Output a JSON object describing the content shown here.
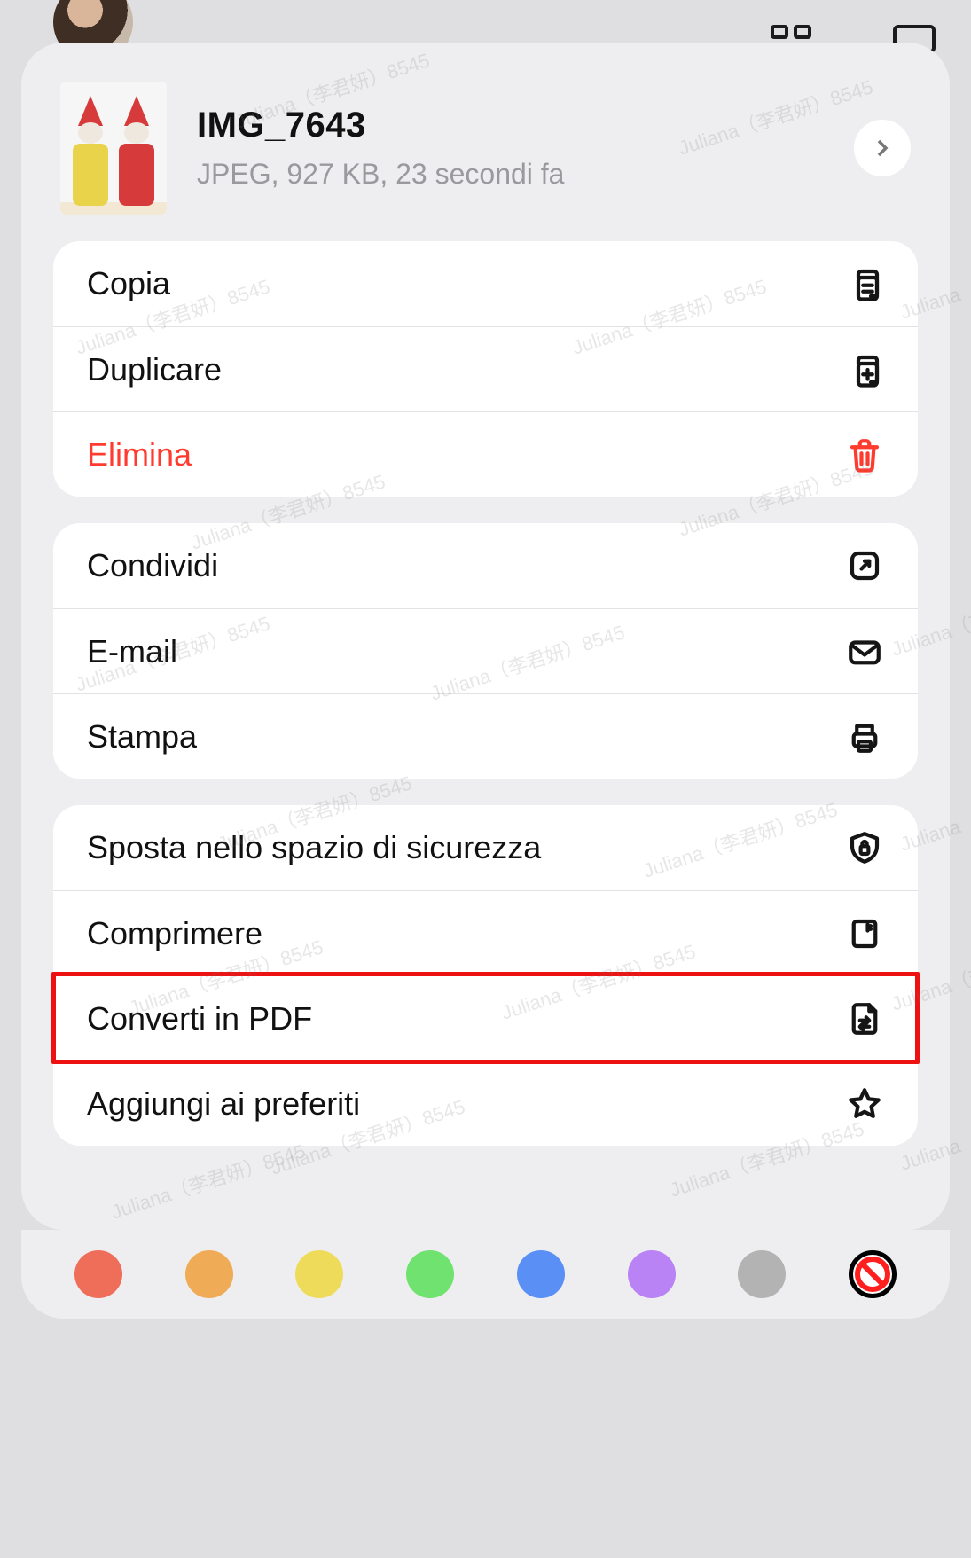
{
  "background_toolbar": {
    "grid_icon": "grid-icon",
    "select_icon": "select-check-icon"
  },
  "file": {
    "title": "IMG_7643",
    "subtitle": "JPEG, 927 KB, 23 secondi fa"
  },
  "groups": [
    {
      "rows": [
        {
          "key": "copy",
          "label": "Copia",
          "icon": "copy-icon",
          "destructive": false
        },
        {
          "key": "duplicate",
          "label": "Duplicare",
          "icon": "duplicate-icon",
          "destructive": false
        },
        {
          "key": "delete",
          "label": "Elimina",
          "icon": "trash-icon",
          "destructive": true
        }
      ]
    },
    {
      "rows": [
        {
          "key": "share",
          "label": "Condividi",
          "icon": "share-icon",
          "destructive": false
        },
        {
          "key": "email",
          "label": "E-mail",
          "icon": "mail-icon",
          "destructive": false
        },
        {
          "key": "print",
          "label": "Stampa",
          "icon": "printer-icon",
          "destructive": false
        }
      ]
    },
    {
      "rows": [
        {
          "key": "move-secure",
          "label": "Sposta nello spazio di sicurezza",
          "icon": "shield-lock-icon",
          "destructive": false
        },
        {
          "key": "compress",
          "label": "Comprimere",
          "icon": "archive-icon",
          "destructive": false
        },
        {
          "key": "convert-pdf",
          "label": "Converti in PDF",
          "icon": "convert-icon",
          "destructive": false,
          "highlighted": true
        },
        {
          "key": "favorite",
          "label": "Aggiungi ai preferiti",
          "icon": "star-icon",
          "destructive": false
        }
      ]
    }
  ],
  "color_tags": [
    {
      "name": "red",
      "hex": "#ef6e5a"
    },
    {
      "name": "orange",
      "hex": "#efab56"
    },
    {
      "name": "yellow",
      "hex": "#efdb5a"
    },
    {
      "name": "green",
      "hex": "#6fe26f"
    },
    {
      "name": "blue",
      "hex": "#5a8ff5"
    },
    {
      "name": "purple",
      "hex": "#b982f5"
    },
    {
      "name": "gray",
      "hex": "#b3b3b3"
    }
  ],
  "no_tag_label": "no-tag",
  "watermark_text": "Juliana（李君妍）8545",
  "colors": {
    "destructive": "#ff3b30"
  }
}
